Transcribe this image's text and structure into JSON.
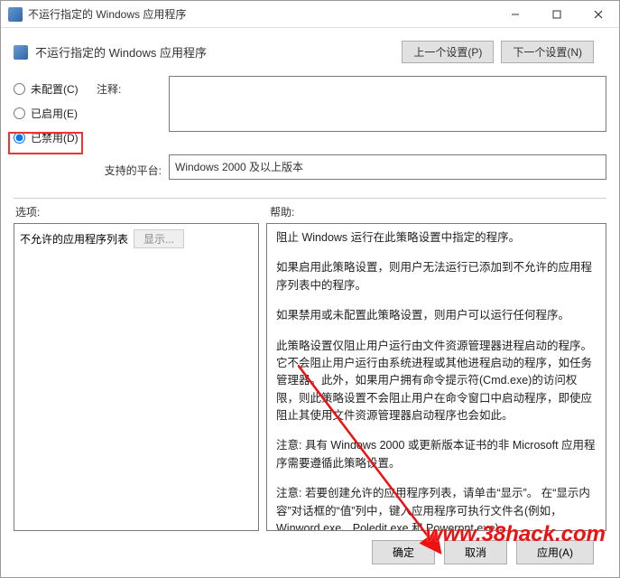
{
  "window": {
    "title": "不运行指定的 Windows 应用程序"
  },
  "header": {
    "title": "不运行指定的 Windows 应用程序",
    "prev": "上一个设置(P)",
    "next": "下一个设置(N)"
  },
  "radios": {
    "not_configured": "未配置(C)",
    "enabled": "已启用(E)",
    "disabled": "已禁用(D)"
  },
  "labels": {
    "comment": "注释:",
    "supported_on": "支持的平台:",
    "options": "选项:",
    "help": "帮助:",
    "disallowed_list": "不允许的应用程序列表",
    "show_btn": "显示..."
  },
  "platform": "Windows 2000 及以上版本",
  "help_text": {
    "p1": "阻止 Windows 运行在此策略设置中指定的程序。",
    "p2": "如果启用此策略设置，则用户无法运行已添加到不允许的应用程序列表中的程序。",
    "p3": "如果禁用或未配置此策略设置，则用户可以运行任何程序。",
    "p4": "此策略设置仅阻止用户运行由文件资源管理器进程启动的程序。它不会阻止用户运行由系统进程或其他进程启动的程序，如任务管理器。此外，如果用户拥有命令提示符(Cmd.exe)的访问权限，则此策略设置不会阻止用户在命令窗口中启动程序，即使应阻止其使用文件资源管理器启动程序也会如此。",
    "p5": "注意: 具有 Windows 2000 或更新版本证书的非 Microsoft 应用程序需要遵循此策略设置。",
    "p6": "注意: 若要创建允许的应用程序列表，请单击“显示”。 在“显示内容”对话框的“值”列中，键入应用程序可执行文件名(例如，Winword.exe、Poledit.exe 和 Powerpnt.exe)。"
  },
  "footer": {
    "ok": "确定",
    "cancel": "取消",
    "apply": "应用(A)"
  },
  "watermark": "www.38hack.com"
}
